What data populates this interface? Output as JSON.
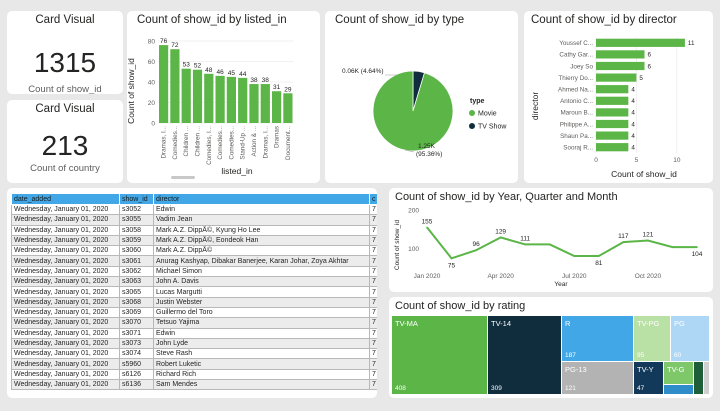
{
  "card1": {
    "title": "Card Visual",
    "value": "1315",
    "label": "Count of show_id"
  },
  "card2": {
    "title": "Card Visual",
    "value": "213",
    "label": "Count of country"
  },
  "listed_in_chart": {
    "title": "Count of show_id by listed_in",
    "xlabel": "listed_in",
    "ylabel": "Count of show_id",
    "color": "#5bb547"
  },
  "type_chart": {
    "title": "Count of show_id by type",
    "legend_title": "type",
    "label_tv": "0.06K (4.64%)",
    "label_movie_line1": "1.25K",
    "label_movie_line2": "(95.36%)",
    "colors": {
      "Movie": "#5bb547",
      "TV Show": "#0f2d3d"
    }
  },
  "director_chart": {
    "title": "Count of show_id by director",
    "xlabel": "Count of show_id",
    "ylabel": "director"
  },
  "table": {
    "columns": [
      "date_added",
      "show_id",
      "director",
      "c"
    ],
    "rows": [
      [
        "Wednesday, January 01, 2020",
        "s3052",
        "Edwin",
        "7"
      ],
      [
        "Wednesday, January 01, 2020",
        "s3055",
        "Vadim Jean",
        "7"
      ],
      [
        "Wednesday, January 01, 2020",
        "s3058",
        "Mark A.Z. DippÃ©, Kyung Ho Lee",
        "7"
      ],
      [
        "Wednesday, January 01, 2020",
        "s3059",
        "Mark A.Z. DippÃ©, Eondeok Han",
        "7"
      ],
      [
        "Wednesday, January 01, 2020",
        "s3060",
        "Mark A.Z. DippÃ©",
        "7"
      ],
      [
        "Wednesday, January 01, 2020",
        "s3061",
        "Anurag Kashyap, Dibakar Banerjee, Karan Johar, Zoya Akhtar",
        "7"
      ],
      [
        "Wednesday, January 01, 2020",
        "s3062",
        "Michael Simon",
        "7"
      ],
      [
        "Wednesday, January 01, 2020",
        "s3063",
        "John A. Davis",
        "7"
      ],
      [
        "Wednesday, January 01, 2020",
        "s3065",
        "Lucas Margutti",
        "7"
      ],
      [
        "Wednesday, January 01, 2020",
        "s3068",
        "Justin Webster",
        "7"
      ],
      [
        "Wednesday, January 01, 2020",
        "s3069",
        "Guillermo del Toro",
        "7"
      ],
      [
        "Wednesday, January 01, 2020",
        "s3070",
        "Tetsuo Yajima",
        "7"
      ],
      [
        "Wednesday, January 01, 2020",
        "s3071",
        "Edwin",
        "7"
      ],
      [
        "Wednesday, January 01, 2020",
        "s3073",
        "John Lyde",
        "7"
      ],
      [
        "Wednesday, January 01, 2020",
        "s3074",
        "Steve Rash",
        "7"
      ],
      [
        "Wednesday, January 01, 2020",
        "s5960",
        "Robert Luketic",
        "7"
      ],
      [
        "Wednesday, January 01, 2020",
        "s6126",
        "Richard Rich",
        "7"
      ],
      [
        "Wednesday, January 01, 2020",
        "s6136",
        "Sam Mendes",
        "7"
      ]
    ]
  },
  "line_chart": {
    "title": "Count of show_id by Year, Quarter and Month",
    "xlabel": "Year",
    "ylabel": "Count of show_id",
    "color": "#5bb547"
  },
  "rating_chart": {
    "title": "Count of show_id by rating",
    "tiles": [
      {
        "name": "TV-MA",
        "value": "408",
        "color": "#5bb547"
      },
      {
        "name": "TV-14",
        "value": "309",
        "color": "#0f2d3d"
      },
      {
        "name": "R",
        "value": "187",
        "color": "#41a7e6"
      },
      {
        "name": "PG-13",
        "value": "121",
        "color": "#b3b3b3"
      },
      {
        "name": "TV-PG",
        "value": "95",
        "color": "#b9e0a5"
      },
      {
        "name": "PG",
        "value": "60",
        "color": "#aed6f5"
      },
      {
        "name": "TV-Y",
        "value": "47",
        "color": "#12395a"
      },
      {
        "name": "TV-G",
        "value": "",
        "color": "#7fc86a"
      },
      {
        "name": "",
        "value": "",
        "color": "#2e8cc8"
      },
      {
        "name": "",
        "value": "",
        "color": "#1e5f3a"
      },
      {
        "name": "",
        "value": "",
        "color": "#d0d0d0"
      }
    ]
  },
  "chart_data": [
    {
      "type": "bar",
      "title": "Count of show_id by listed_in",
      "xlabel": "listed_in",
      "ylabel": "Count of show_id",
      "categories": [
        "Dramas, I...",
        "Comedies...",
        "Children ...",
        "Children ...",
        "Comedies, I...",
        "Comedies...",
        "Comedies...",
        "Stand-Up ...",
        "Action & ...",
        "Dramas, I...",
        "Dramas",
        "Document..."
      ],
      "values": [
        76,
        72,
        53,
        52,
        48,
        46,
        45,
        44,
        38,
        38,
        31,
        29
      ],
      "ylim": [
        0,
        80
      ],
      "yticks": [
        0,
        20,
        40,
        60,
        80
      ]
    },
    {
      "type": "pie",
      "title": "Count of show_id by type",
      "categories": [
        "Movie",
        "TV Show"
      ],
      "values": [
        95.36,
        4.64
      ]
    },
    {
      "type": "bar",
      "orientation": "horizontal",
      "title": "Count of show_id by director",
      "xlabel": "Count of show_id",
      "ylabel": "director",
      "categories": [
        "Youssef C...",
        "Cathy Gar...",
        "Joey So",
        "Thierry Do...",
        "Ahmed Na...",
        "Antonio C...",
        "Maroun B...",
        "Philippe A...",
        "Shaun Pa...",
        "Sooraj R..."
      ],
      "values": [
        11,
        6,
        6,
        5,
        4,
        4,
        4,
        4,
        4,
        4
      ],
      "xlim": [
        0,
        12
      ],
      "xticks": [
        0,
        5,
        10
      ]
    },
    {
      "type": "line",
      "title": "Count of show_id by Year, Quarter and Month",
      "xlabel": "Year",
      "ylabel": "Count of show_id",
      "x": [
        "Jan 2020",
        "Feb 2020",
        "Mar 2020",
        "Apr 2020",
        "May 2020",
        "Jun 2020",
        "Jul 2020",
        "Aug 2020",
        "Sep 2020",
        "Oct 2020",
        "Nov 2020",
        "Dec 2020"
      ],
      "values": [
        155,
        75,
        96,
        129,
        111,
        111,
        81,
        81,
        117,
        121,
        104,
        104
      ],
      "point_labels": [
        155,
        75,
        96,
        129,
        111,
        null,
        null,
        81,
        117,
        121,
        null,
        104
      ],
      "xtick_labels": [
        "Jan 2020",
        "Apr 2020",
        "Jul 2020",
        "Oct 2020"
      ],
      "ylim": [
        50,
        200
      ],
      "yticks": [
        100,
        200
      ]
    }
  ]
}
